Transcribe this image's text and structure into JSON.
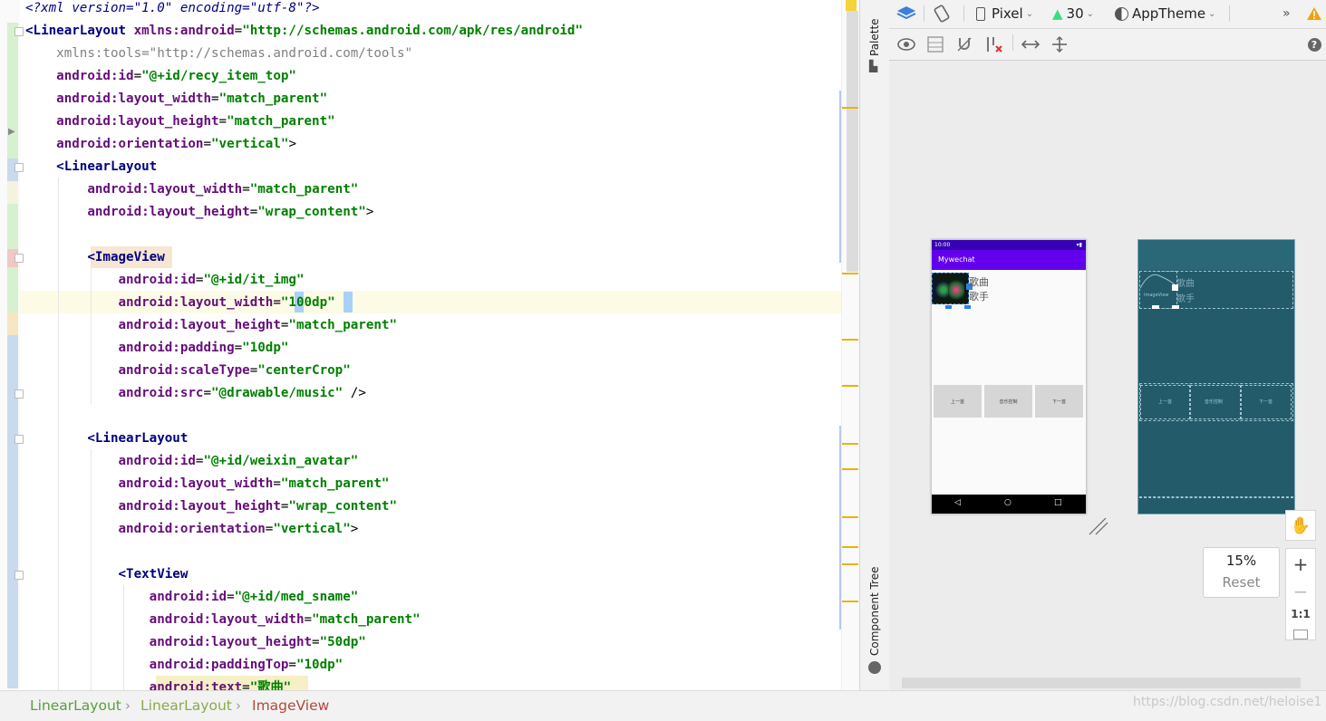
{
  "editor": {
    "lines": [
      {
        "segments": [
          [
            "prolog",
            "<?xml version=\"1.0\" encoding=\"utf-8\"?>"
          ]
        ]
      },
      {
        "segments": [
          [
            "tag",
            "<LinearLayout "
          ],
          [
            "ns",
            "xmlns:android"
          ],
          [
            "plain",
            "="
          ],
          [
            "val",
            "\"http://schemas.android.com/apk/res/android\""
          ]
        ]
      },
      {
        "segments": [
          [
            "tools",
            "    xmlns:tools=\"http://schemas.android.com/tools\""
          ]
        ]
      },
      {
        "segments": [
          [
            "plain",
            "    "
          ],
          [
            "attr",
            "android:id"
          ],
          [
            "plain",
            "="
          ],
          [
            "val",
            "\"@+id/recy_item_top\""
          ]
        ]
      },
      {
        "segments": [
          [
            "plain",
            "    "
          ],
          [
            "attr",
            "android:layout_width"
          ],
          [
            "plain",
            "="
          ],
          [
            "val",
            "\"match_parent\""
          ]
        ]
      },
      {
        "segments": [
          [
            "plain",
            "    "
          ],
          [
            "attr",
            "android:layout_height"
          ],
          [
            "plain",
            "="
          ],
          [
            "val",
            "\"match_parent\""
          ]
        ]
      },
      {
        "segments": [
          [
            "plain",
            "    "
          ],
          [
            "attr",
            "android:orientation"
          ],
          [
            "plain",
            "="
          ],
          [
            "val",
            "\"vertical\""
          ],
          [
            "plain",
            ">"
          ]
        ]
      },
      {
        "segments": [
          [
            "plain",
            "    "
          ],
          [
            "tag",
            "<LinearLayout"
          ]
        ]
      },
      {
        "segments": [
          [
            "plain",
            "        "
          ],
          [
            "attr",
            "android:layout_width"
          ],
          [
            "plain",
            "="
          ],
          [
            "val",
            "\"match_parent\""
          ]
        ]
      },
      {
        "segments": [
          [
            "plain",
            "        "
          ],
          [
            "attr",
            "android:layout_height"
          ],
          [
            "plain",
            "="
          ],
          [
            "val",
            "\"wrap_content\""
          ],
          [
            "plain",
            ">"
          ]
        ]
      },
      {
        "segments": [
          [
            "plain",
            ""
          ]
        ]
      },
      {
        "segments": [
          [
            "plain",
            "        "
          ],
          [
            "tag",
            "<ImageView"
          ]
        ]
      },
      {
        "segments": [
          [
            "plain",
            "            "
          ],
          [
            "attr",
            "android:id"
          ],
          [
            "plain",
            "="
          ],
          [
            "val",
            "\"@+id/it_img\""
          ]
        ]
      },
      {
        "segments": [
          [
            "plain",
            "            "
          ],
          [
            "attr",
            "android:layout_width"
          ],
          [
            "plain",
            "="
          ],
          [
            "val",
            "\"100dp\""
          ]
        ]
      },
      {
        "segments": [
          [
            "plain",
            "            "
          ],
          [
            "attr",
            "android:layout_height"
          ],
          [
            "plain",
            "="
          ],
          [
            "val",
            "\"match_parent\""
          ]
        ]
      },
      {
        "segments": [
          [
            "plain",
            "            "
          ],
          [
            "attr",
            "android:padding"
          ],
          [
            "plain",
            "="
          ],
          [
            "val",
            "\"10dp\""
          ]
        ]
      },
      {
        "segments": [
          [
            "plain",
            "            "
          ],
          [
            "attr",
            "android:scaleType"
          ],
          [
            "plain",
            "="
          ],
          [
            "val",
            "\"centerCrop\""
          ]
        ]
      },
      {
        "segments": [
          [
            "plain",
            "            "
          ],
          [
            "attr",
            "android:src"
          ],
          [
            "plain",
            "="
          ],
          [
            "val",
            "\"@drawable/music\""
          ],
          [
            "plain",
            " />"
          ]
        ]
      },
      {
        "segments": [
          [
            "plain",
            ""
          ]
        ]
      },
      {
        "segments": [
          [
            "plain",
            "        "
          ],
          [
            "tag",
            "<LinearLayout"
          ]
        ]
      },
      {
        "segments": [
          [
            "plain",
            "            "
          ],
          [
            "attr",
            "android:id"
          ],
          [
            "plain",
            "="
          ],
          [
            "val",
            "\"@+id/weixin_avatar\""
          ]
        ]
      },
      {
        "segments": [
          [
            "plain",
            "            "
          ],
          [
            "attr",
            "android:layout_width"
          ],
          [
            "plain",
            "="
          ],
          [
            "val",
            "\"match_parent\""
          ]
        ]
      },
      {
        "segments": [
          [
            "plain",
            "            "
          ],
          [
            "attr",
            "android:layout_height"
          ],
          [
            "plain",
            "="
          ],
          [
            "val",
            "\"wrap_content\""
          ]
        ]
      },
      {
        "segments": [
          [
            "plain",
            "            "
          ],
          [
            "attr",
            "android:orientation"
          ],
          [
            "plain",
            "="
          ],
          [
            "val",
            "\"vertical\""
          ],
          [
            "plain",
            ">"
          ]
        ]
      },
      {
        "segments": [
          [
            "plain",
            ""
          ]
        ]
      },
      {
        "segments": [
          [
            "plain",
            "            "
          ],
          [
            "tag",
            "<TextView"
          ]
        ]
      },
      {
        "segments": [
          [
            "plain",
            "                "
          ],
          [
            "attr",
            "android:id"
          ],
          [
            "plain",
            "="
          ],
          [
            "val",
            "\"@+id/med_sname\""
          ]
        ]
      },
      {
        "segments": [
          [
            "plain",
            "                "
          ],
          [
            "attr",
            "android:layout_width"
          ],
          [
            "plain",
            "="
          ],
          [
            "val",
            "\"match_parent\""
          ]
        ]
      },
      {
        "segments": [
          [
            "plain",
            "                "
          ],
          [
            "attr",
            "android:layout_height"
          ],
          [
            "plain",
            "="
          ],
          [
            "val",
            "\"50dp\""
          ]
        ]
      },
      {
        "segments": [
          [
            "plain",
            "                "
          ],
          [
            "attr",
            "android:paddingTop"
          ],
          [
            "plain",
            "="
          ],
          [
            "val",
            "\"10dp\""
          ]
        ]
      },
      {
        "segments": [
          [
            "plain",
            "                "
          ],
          [
            "attr",
            "android:text"
          ],
          [
            "plain",
            "="
          ],
          [
            "val",
            "\"歌曲\""
          ]
        ]
      }
    ]
  },
  "side_panel": {
    "palette_label": "Palette",
    "component_tree_label": "Component Tree"
  },
  "toolbar": {
    "device_label": "Pixel",
    "api_label": "30",
    "theme_label": "AppTheme",
    "overflow_label": "»"
  },
  "phone_preview": {
    "status_time": "10:00",
    "app_title": "Mywechat",
    "song_label": "歌曲",
    "singer_label": "歌手",
    "buttons": [
      "上一首",
      "音乐控制",
      "下一首"
    ],
    "nav_back": "◁",
    "nav_home": "○",
    "nav_recent": "□"
  },
  "blueprint": {
    "song_label": "歌曲",
    "singer_label": "歌手",
    "image_label": "ImageView",
    "buttons": [
      "上一首",
      "音乐控制",
      "下一首"
    ]
  },
  "zoom": {
    "percent": "15%",
    "reset_label": "Reset",
    "one_to_one": "1:1"
  },
  "breadcrumb": {
    "items": [
      "LinearLayout",
      "LinearLayout",
      "ImageView"
    ]
  },
  "watermark": "https://blog.csdn.net/heloise1",
  "colors": {
    "tag": "#000080",
    "attr": "#660e7a",
    "value": "#008000",
    "breadcrumb_green": "#5a9e3a",
    "breadcrumb_active": "#b5473a",
    "app_bar": "#6200ee",
    "status_bar": "#3700b3",
    "blueprint_bg": "#235b6a"
  }
}
